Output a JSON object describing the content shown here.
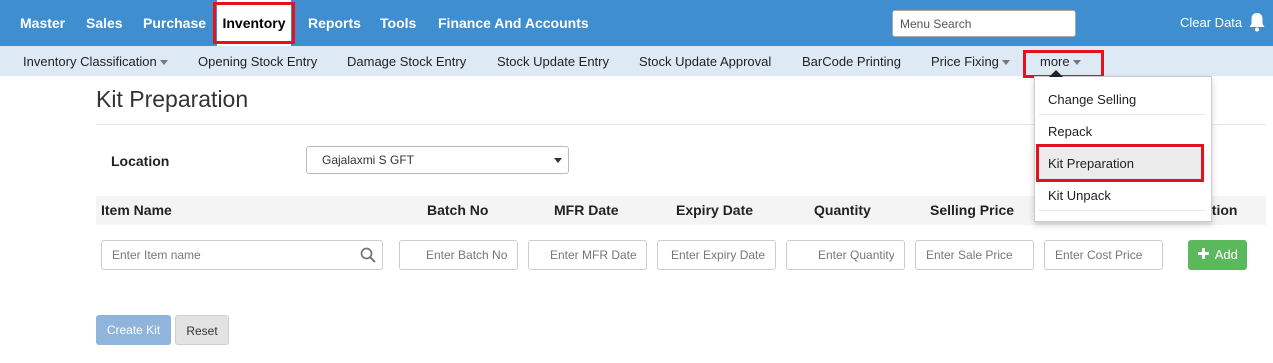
{
  "top_nav": {
    "items": [
      "Master",
      "Sales",
      "Purchase",
      "Inventory",
      "Reports",
      "Tools",
      "Finance And Accounts"
    ],
    "active": "Inventory",
    "search_placeholder": "Menu Search",
    "clear_data": "Clear Data",
    "bell_icon": "bell-icon"
  },
  "sub_nav": {
    "items": [
      "Inventory Classification",
      "Opening Stock Entry",
      "Damage Stock Entry",
      "Stock Update Entry",
      "Stock Update Approval",
      "BarCode Printing",
      "Price Fixing",
      "more"
    ]
  },
  "more_menu": {
    "items": [
      "Change Selling",
      "Repack",
      "Kit Preparation",
      "Kit Unpack"
    ],
    "selected": "Kit Preparation"
  },
  "page": {
    "title": "Kit Preparation",
    "location_label": "Location",
    "location_value": "Gajalaxmi S GFT"
  },
  "table": {
    "headers": [
      "Item Name",
      "Batch No",
      "MFR Date",
      "Expiry Date",
      "Quantity",
      "Selling Price",
      "ction"
    ],
    "placeholders": {
      "item": "Enter Item name",
      "batch": "Enter Batch No",
      "mfr": "Enter MFR Date",
      "expiry": "Enter Expiry Date",
      "quantity": "Enter Quantity",
      "sale_price": "Enter Sale Price",
      "cost_price": "Enter Cost Price"
    },
    "add_label": "Add"
  },
  "actions": {
    "create": "Create Kit",
    "reset": "Reset"
  },
  "colors": {
    "topbar": "#3e8ed0",
    "subbar": "#ddeaf6",
    "highlight": "#e0141e",
    "add_button": "#5cb85c",
    "create_button": "#8fb5dc"
  }
}
